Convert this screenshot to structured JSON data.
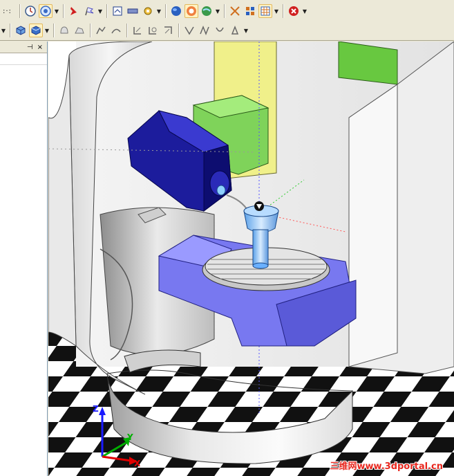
{
  "toolbar_top": {
    "lead_text": ":·:",
    "groups": [
      [
        "clock-icon",
        "target-icon"
      ],
      [
        "pushpin-icon",
        "flag-icon"
      ],
      [
        "window-icon",
        "ruler-icon",
        "gear-icon"
      ],
      [
        "globe-icon",
        "shaded-globe-icon",
        "earth-icon"
      ],
      [
        "scatter-icon",
        "pattern-icon",
        "grid-icon"
      ],
      [
        "stop-icon"
      ]
    ]
  },
  "toolbar_second": {
    "groups": [
      [
        "cube-icon",
        "shaded-cube-icon"
      ],
      [
        "shape-a-icon",
        "shape-b-icon"
      ],
      [
        "curve-a-icon",
        "curve-b-icon"
      ],
      [
        "clip-a-icon",
        "clip-b-icon",
        "clip-c-icon"
      ],
      [
        "sketch-a-icon",
        "sketch-b-icon",
        "sketch-c-icon",
        "sketch-d-icon"
      ]
    ]
  },
  "side_panel": {
    "pin_glyph": "⊣",
    "close_glyph": "×"
  },
  "axes": {
    "x_label": "X",
    "y_label": "Y",
    "z_label": "Z",
    "x_color": "#e00000",
    "y_color": "#00b000",
    "z_color": "#1a1aff"
  },
  "watermark": "三维网www.3dportal.cn",
  "colors": {
    "spindle_blue": "#1c1c9c",
    "table_violet": "#7878f0",
    "green_block": "#7fd35a",
    "yellow_panel": "#f0f08a"
  }
}
